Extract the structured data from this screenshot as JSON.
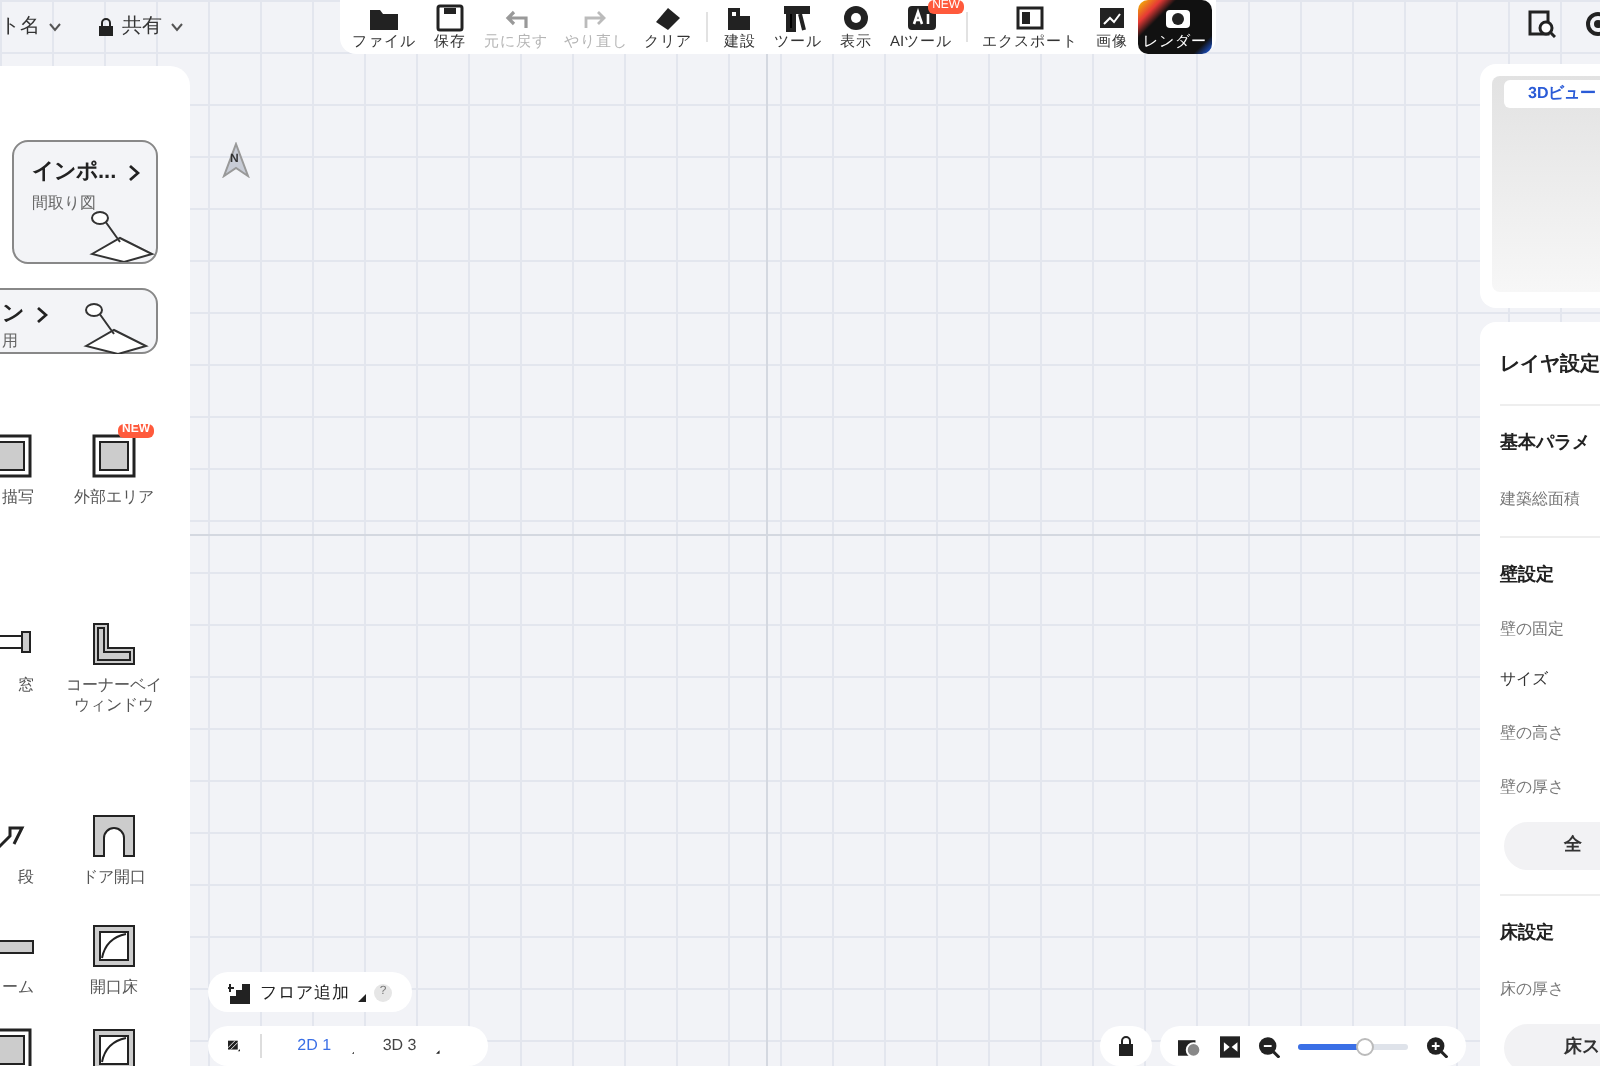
{
  "header": {
    "project": "ト名",
    "share": "共有"
  },
  "toolbar": [
    {
      "label": "ファイル",
      "disabled": false
    },
    {
      "label": "保存",
      "disabled": false
    },
    {
      "label": "元に戻す",
      "disabled": true
    },
    {
      "label": "やり直し",
      "disabled": true
    },
    {
      "label": "クリア",
      "disabled": false
    },
    {
      "label": "建設",
      "disabled": false
    },
    {
      "label": "ツール",
      "disabled": false
    },
    {
      "label": "表示",
      "disabled": false
    },
    {
      "label": "AIツール",
      "disabled": false,
      "badge": "NEW"
    },
    {
      "label": "エクスポート",
      "disabled": false
    },
    {
      "label": "画像",
      "disabled": false
    },
    {
      "label": "レンダー",
      "disabled": false,
      "kind": "render"
    }
  ],
  "sidebar": {
    "cards": [
      {
        "title": "インポ...",
        "subtitle": "間取り図"
      },
      {
        "title": "ン",
        "subtitle": "用"
      }
    ],
    "tools": [
      {
        "label": "描写"
      },
      {
        "label": "外部エリア",
        "badge": "NEW"
      },
      {
        "label": "窓"
      },
      {
        "label": "コーナーベイウィンドウ"
      },
      {
        "label": "段"
      },
      {
        "label": "ドア開口"
      },
      {
        "label": "ーム"
      },
      {
        "label": "開口床"
      }
    ]
  },
  "compass": "N",
  "view3d": {
    "title": "3Dビュー"
  },
  "layer_panel": {
    "title": "レイヤ設定",
    "sections": [
      {
        "title": "基本パラメ",
        "rows": [
          {
            "kind": "field",
            "label": "建築総面積"
          }
        ]
      },
      {
        "title": "壁設定",
        "rows": [
          {
            "kind": "field",
            "label": "壁の固定"
          },
          {
            "kind": "heading",
            "label": "サイズ"
          },
          {
            "kind": "field",
            "label": "壁の高さ"
          },
          {
            "kind": "field",
            "label": "壁の厚さ"
          },
          {
            "kind": "button",
            "label": "全"
          }
        ]
      },
      {
        "title": "床設定",
        "rows": [
          {
            "kind": "field",
            "label": "床の厚さ"
          },
          {
            "kind": "button",
            "label": "床ス"
          }
        ]
      }
    ]
  },
  "floor_bar": {
    "add": "フロア追加",
    "help": "?"
  },
  "view_tabs": [
    {
      "label": "2D 1",
      "selected": true
    },
    {
      "label": "3D 3",
      "selected": false
    }
  ],
  "zoom": {
    "level": 0.6
  }
}
